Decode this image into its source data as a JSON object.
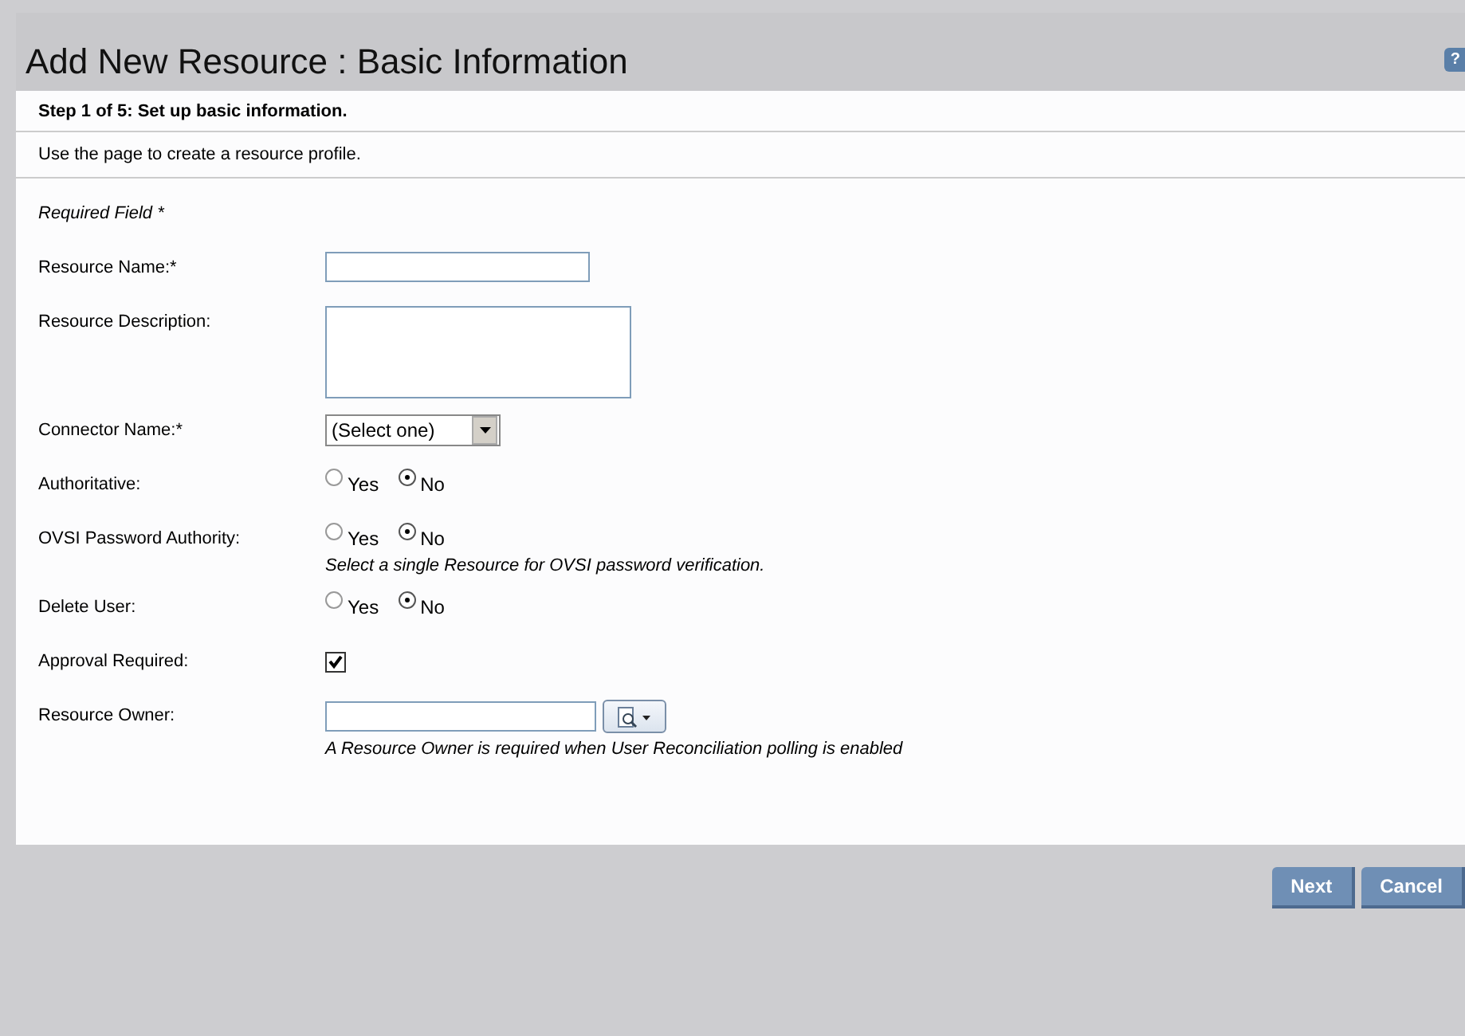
{
  "header": {
    "title": "Add New Resource : Basic Information",
    "help": "?"
  },
  "step": "Step 1 of 5: Set up basic information.",
  "intro": "Use the page to create a resource profile.",
  "required_note": "Required Field *",
  "fields": [
    {
      "kind": "text",
      "label": "Resource Name:*"
    },
    {
      "kind": "textarea",
      "label": "Resource Description:"
    },
    {
      "kind": "select",
      "label": "Connector Name:*",
      "value": "(Select one)"
    },
    {
      "kind": "radio",
      "label": "Authoritative:",
      "options": [
        {
          "label": "Yes",
          "selected": false
        },
        {
          "label": "No",
          "selected": true
        }
      ]
    },
    {
      "kind": "radio",
      "label": "OVSI Password Authority:",
      "options": [
        {
          "label": "Yes",
          "selected": false
        },
        {
          "label": "No",
          "selected": true
        }
      ],
      "note": "Select a single Resource for OVSI password verification."
    },
    {
      "kind": "radio",
      "label": "Delete User:",
      "options": [
        {
          "label": "Yes",
          "selected": false
        },
        {
          "label": "No",
          "selected": true
        }
      ]
    },
    {
      "kind": "checkbox",
      "label": "Approval Required:",
      "checked": true
    },
    {
      "kind": "lookup",
      "label": "Resource Owner:",
      "note": "A Resource Owner is required when User Reconciliation polling is enabled"
    }
  ],
  "buttons": [
    "Next",
    "Cancel"
  ]
}
